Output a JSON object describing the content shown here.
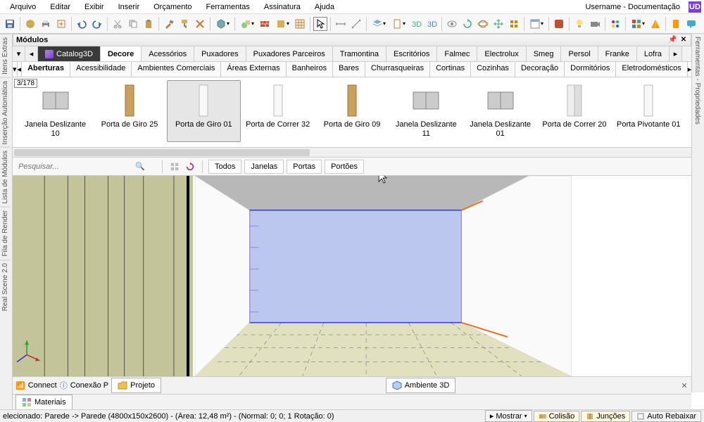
{
  "menu": {
    "items": [
      "Arquivo",
      "Editar",
      "Exibir",
      "Inserir",
      "Orçamento",
      "Ferramentas",
      "Assinatura",
      "Ajuda"
    ],
    "user": "Username - Documentação",
    "badge": "UD"
  },
  "panel": {
    "title": "Módulos"
  },
  "tabs1": {
    "catalog": "Catalog3D",
    "items": [
      "Decore",
      "Acessórios",
      "Puxadores",
      "Puxadores Parceiros",
      "Tramontina",
      "Escritórios",
      "Falmec",
      "Electrolux",
      "Smeg",
      "Persol",
      "Franke",
      "Lofra"
    ]
  },
  "tabs2": {
    "items": [
      "Aberturas",
      "Acessibilidade",
      "Ambientes Comerciais",
      "Áreas Externas",
      "Banheiros",
      "Bares",
      "Churrasqueiras",
      "Cortinas",
      "Cozinhas",
      "Decoração",
      "Dormitórios",
      "Eletrodomésticos"
    ]
  },
  "counter": "3/178",
  "thumbs": [
    {
      "label": "Janela Deslizante 10"
    },
    {
      "label": "Porta de Giro 25"
    },
    {
      "label": "Porta de Giro 01"
    },
    {
      "label": "Porta de Correr 32"
    },
    {
      "label": "Porta de Giro 09"
    },
    {
      "label": "Janela Deslizante 11"
    },
    {
      "label": "Janela Deslizante 01"
    },
    {
      "label": "Porta de Correr 20"
    },
    {
      "label": "Porta Pivotante 01"
    }
  ],
  "search": {
    "placeholder": "Pesquisar..."
  },
  "filters": [
    "Todos",
    "Janelas",
    "Portas",
    "Portões"
  ],
  "btabs": {
    "connect": "Connect",
    "conexao": "Conexão P",
    "projeto": "Projeto",
    "ambiente": "Ambiente 3D"
  },
  "mtab": "Materiais",
  "status": {
    "left": "elecionado: Parede -> Parede (4800x150x2600) - (Área: 12,48 m²) - (Normal: 0; 0; 1 Rotação: 0)",
    "mostrar": "Mostrar",
    "colisao": "Colisão",
    "juncoes": "Junções",
    "auto": "Auto Rebaixar"
  },
  "leftvtabs": [
    "Itens Extras",
    "Inserção Automática",
    "Lista de Módulos",
    "Fila de Render",
    "Real Scene 2.0"
  ],
  "rightvtab": "Ferramentas - Propriedades"
}
